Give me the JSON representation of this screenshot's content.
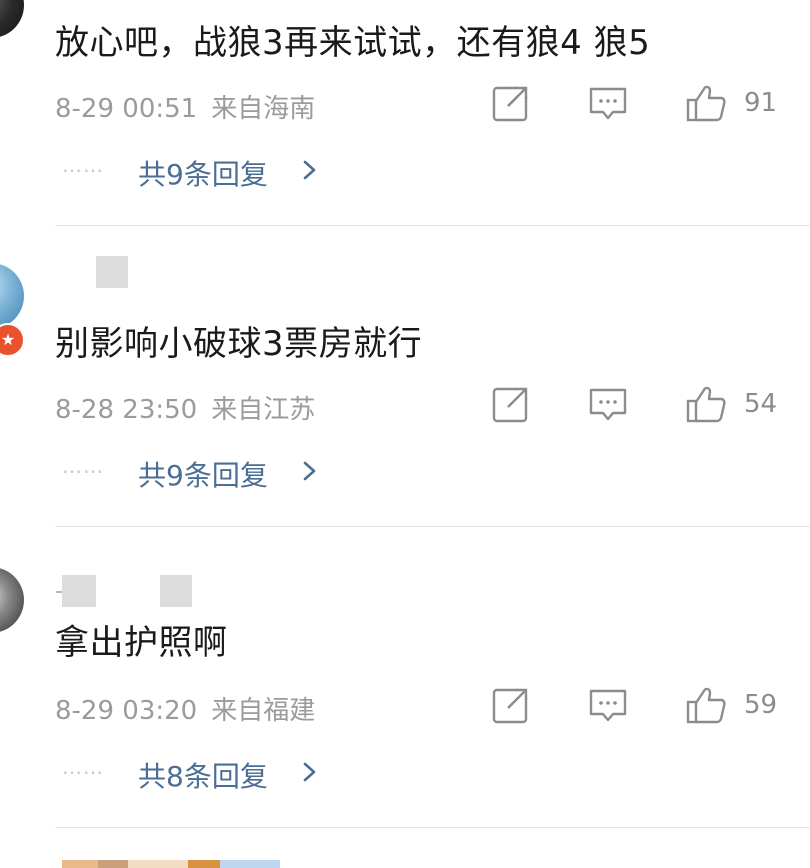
{
  "comments": [
    {
      "text": "放心吧，战狼3再来试试，还有狼4  狼5",
      "time": "8-29 00:51",
      "location": "来自海南",
      "likes": "91",
      "replies_label": "共9条回复"
    },
    {
      "text": "别影响小破球3票房就行",
      "time": "8-28 23:50",
      "location": "来自江苏",
      "likes": "54",
      "replies_label": "共9条回复"
    },
    {
      "text": "拿出护照啊",
      "time": "8-29 03:20",
      "location": "来自福建",
      "likes": "59",
      "replies_label": "共8条回复"
    }
  ],
  "ui": {
    "reply_dots": "……",
    "badge_glyph": "★"
  },
  "colors": {
    "link_blue": "#4a6e94",
    "meta_gray": "#9b9b9b",
    "icon_gray": "#8c8c8c",
    "badge_orange": "#e8522d"
  },
  "icons": {
    "share": "share-icon",
    "reply": "comment-icon",
    "like": "thumbs-up-icon",
    "more": "chevron-right-icon"
  }
}
